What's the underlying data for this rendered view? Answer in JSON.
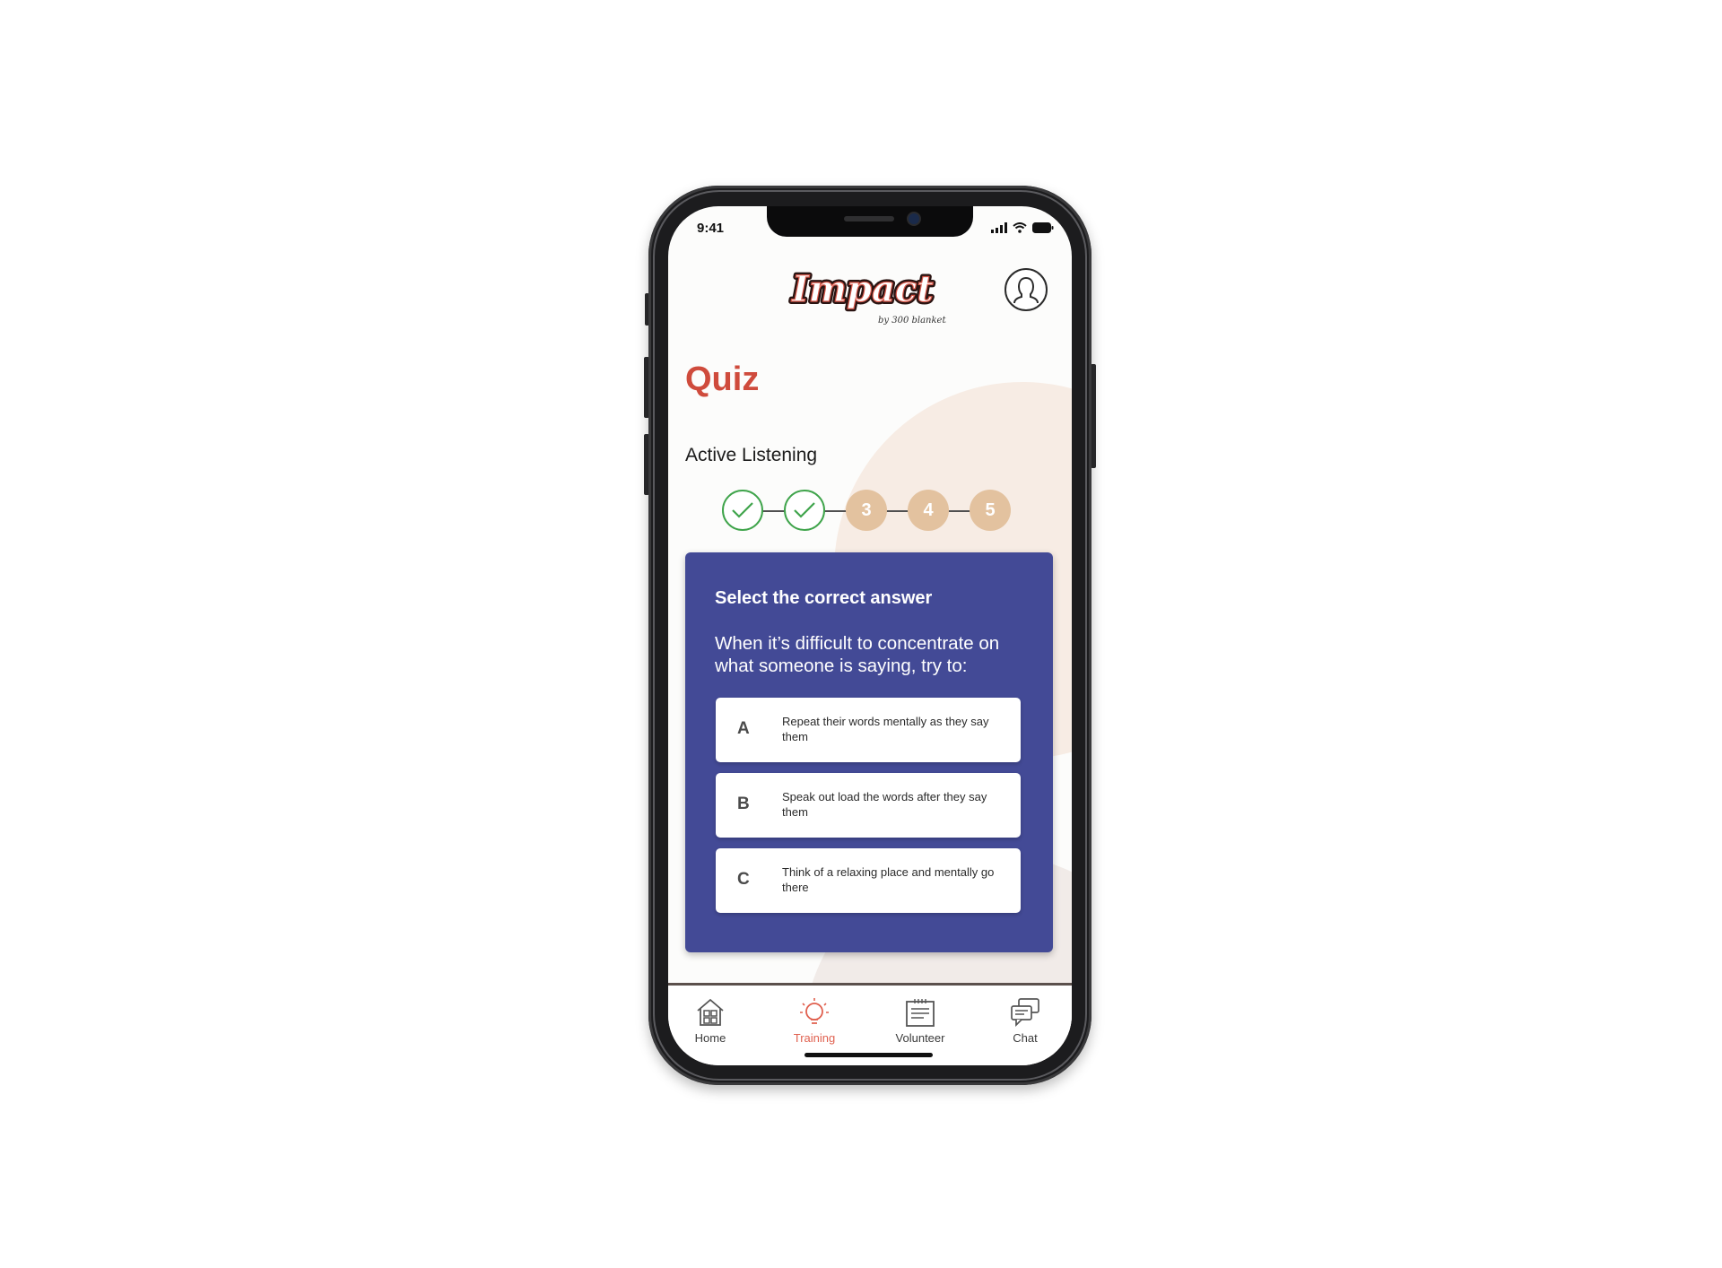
{
  "status_bar": {
    "time": "9:41"
  },
  "header": {
    "logo_text": "Impact",
    "logo_tagline": "by 300 blankets"
  },
  "page": {
    "title": "Quiz",
    "subtitle": "Active Listening"
  },
  "progress": {
    "steps": [
      {
        "label": "",
        "state": "done"
      },
      {
        "label": "",
        "state": "done"
      },
      {
        "label": "3",
        "state": "todo"
      },
      {
        "label": "4",
        "state": "todo"
      },
      {
        "label": "5",
        "state": "todo"
      }
    ]
  },
  "quiz": {
    "heading": "Select the correct answer",
    "question": "When it’s difficult to concentrate on what someone is saying, try to:",
    "options": [
      {
        "letter": "A",
        "text": "Repeat their words mentally as they say them"
      },
      {
        "letter": "B",
        "text": "Speak out load the words after they say them"
      },
      {
        "letter": "C",
        "text": "Think of a relaxing place and mentally go there"
      }
    ]
  },
  "tabbar": {
    "items": [
      {
        "label": "Home",
        "icon": "home-icon"
      },
      {
        "label": "Training",
        "icon": "lightbulb-icon",
        "active": true
      },
      {
        "label": "Volunteer",
        "icon": "notepad-icon"
      },
      {
        "label": "Chat",
        "icon": "chat-icon"
      }
    ]
  },
  "colors": {
    "title_red": "#cf4b3c",
    "card_blue": "#434a96",
    "step_done": "#3fa44b",
    "step_todo": "#e3c29f",
    "tab_active": "#e0604f"
  }
}
